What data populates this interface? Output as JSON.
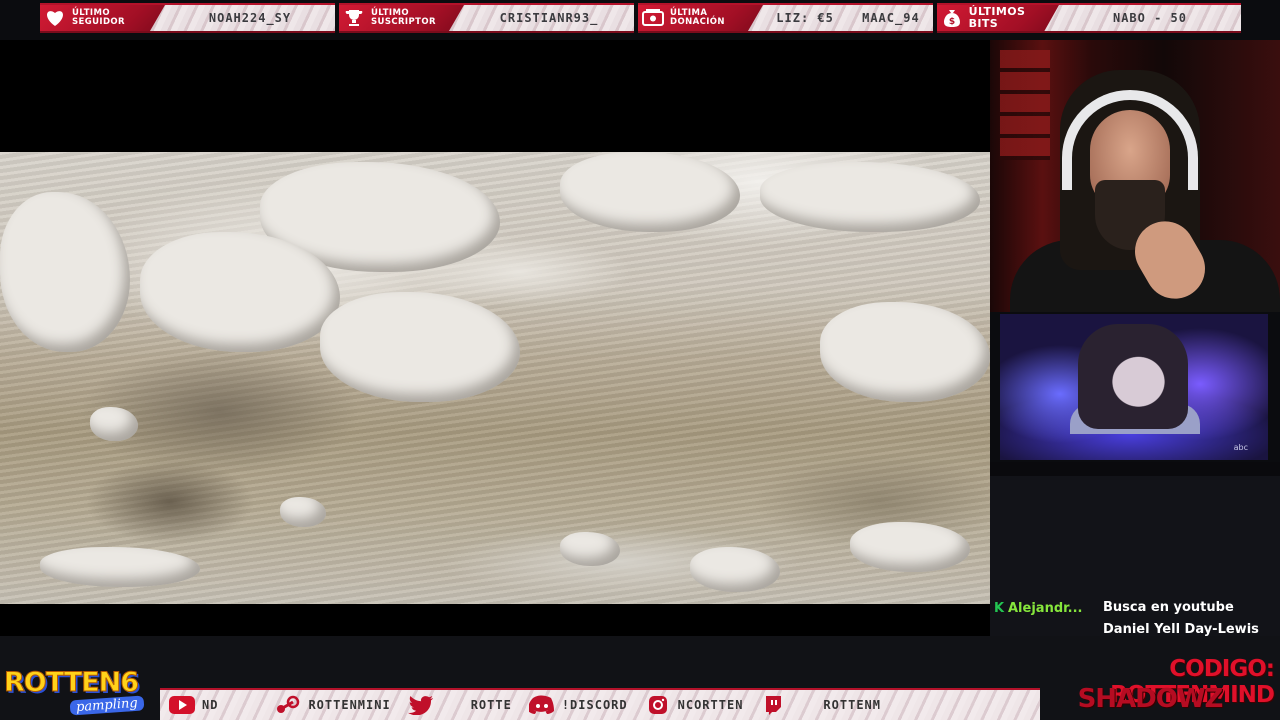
{
  "alerts": [
    {
      "icon": "heart-icon",
      "label": "Último seguidor",
      "value": "NOAH224_SY"
    },
    {
      "icon": "trophy-icon",
      "label": "Último suscriptor",
      "value": "CRISTIANR93_"
    },
    {
      "icon": "donation-icon",
      "label": "Última donación",
      "values": [
        "LIZ: €5",
        "MAAC_94"
      ]
    },
    {
      "icon": "money-bag-icon",
      "label": "Últimos bits",
      "value": "NABO - 50"
    }
  ],
  "clip": {
    "logo": "abc"
  },
  "chat": {
    "badge": "K",
    "username": "Alejandr...",
    "message_line1": "Busca en youtube",
    "message_line2": "Daniel Yell Day-Lewis"
  },
  "brand": {
    "title": "ROTTEN6",
    "subtitle": "pampling"
  },
  "socials": [
    {
      "icon": "youtube-icon",
      "text": "ND"
    },
    {
      "icon": "steam-icon",
      "text": "ROTTENMINI"
    },
    {
      "icon": "twitter-icon",
      "text": "ROTTE"
    },
    {
      "icon": "discord-icon",
      "text": "!DISCORD"
    },
    {
      "icon": "instagram-icon",
      "text": "NCORTTEN"
    },
    {
      "icon": "twitch-icon",
      "text": "ROTTENM"
    }
  ],
  "code_text": "CODIGO: ROTTENMIND",
  "partner_text": "SHADOWZ",
  "colors": {
    "accent_red": "#b3122a",
    "brand_yellow": "#ffd21a",
    "chat_username": "#86e63c"
  }
}
